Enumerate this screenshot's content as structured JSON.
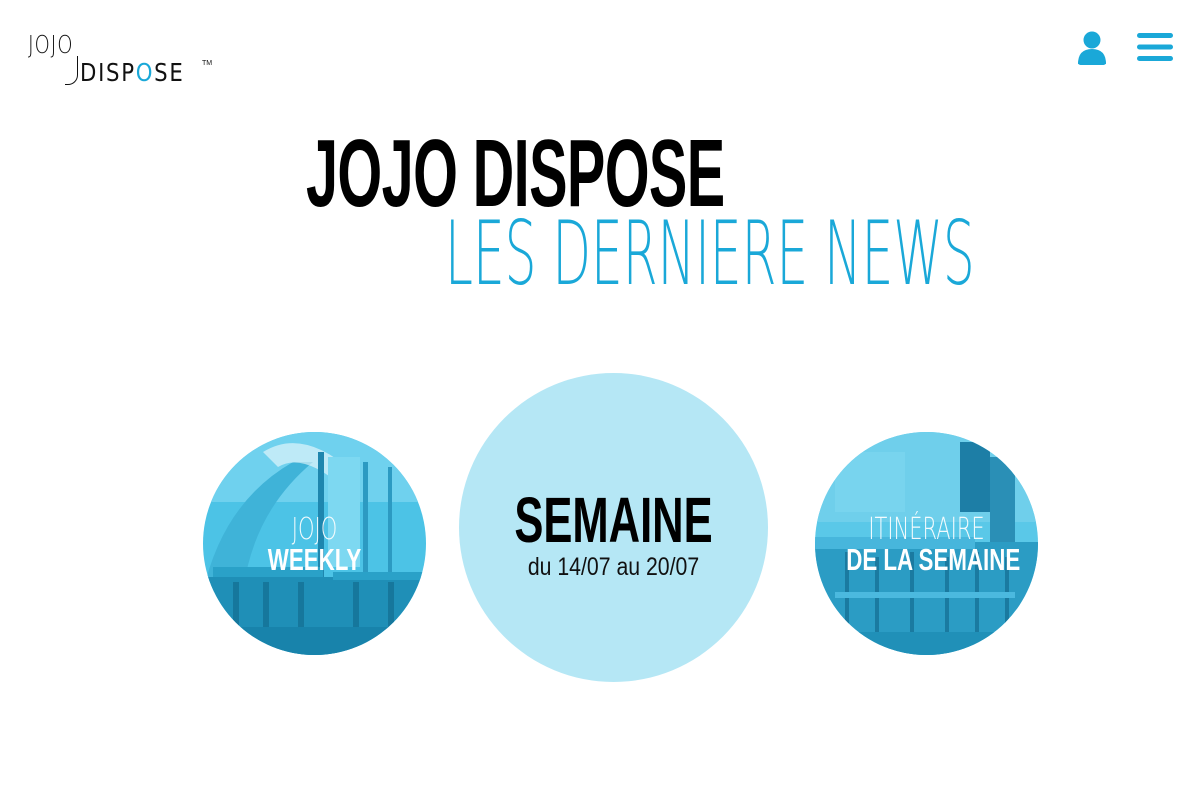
{
  "brand": {
    "logo_line1": "JOJO",
    "logo_line2_a": "DISP",
    "logo_line2_pin": "O",
    "logo_line2_b": "SE",
    "logo_tm": "TM",
    "accent_color": "#1aa8d8",
    "light_color": "#b5e7f5"
  },
  "header": {
    "user_icon": "user-icon",
    "menu_icon": "hamburger-menu-icon"
  },
  "hero": {
    "title": "JOJO DISPOSE",
    "subtitle": "LES DERNIERE NEWS"
  },
  "cards": {
    "weekly": {
      "line1": "JOJO",
      "line2": "WEEKLY"
    },
    "week": {
      "title": "SEMAINE",
      "dates": "du 14/07 au 20/07"
    },
    "itinerary": {
      "line1": "ITINÉRAIRE",
      "line2": "DE LA SEMAINE"
    }
  }
}
